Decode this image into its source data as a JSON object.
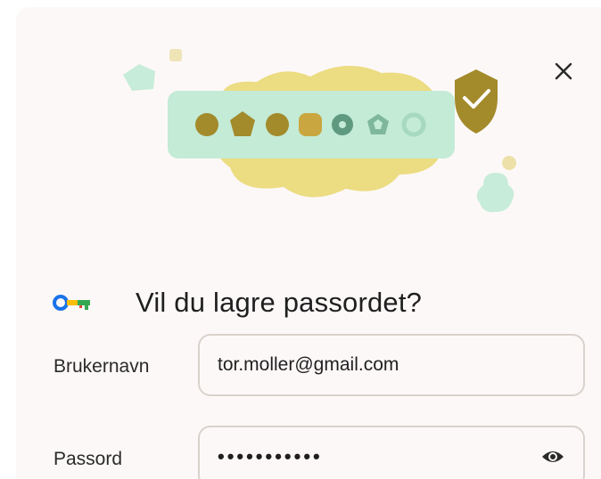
{
  "dialog": {
    "title": "Vil du lagre passordet?",
    "close_icon": "close-icon",
    "key_icon": "password-key-icon"
  },
  "form": {
    "username_label": "Brukernavn",
    "username_value": "tor.moller@gmail.com",
    "password_label": "Passord",
    "password_value": "•••••••••••",
    "show_password_icon": "eye-icon"
  },
  "colors": {
    "olive": "#a38a2b",
    "yellow_cloud": "#ecdc82",
    "mint": "#bfe9d4",
    "shield": "#a38a2b",
    "accent_blue": "#1a73e8"
  }
}
